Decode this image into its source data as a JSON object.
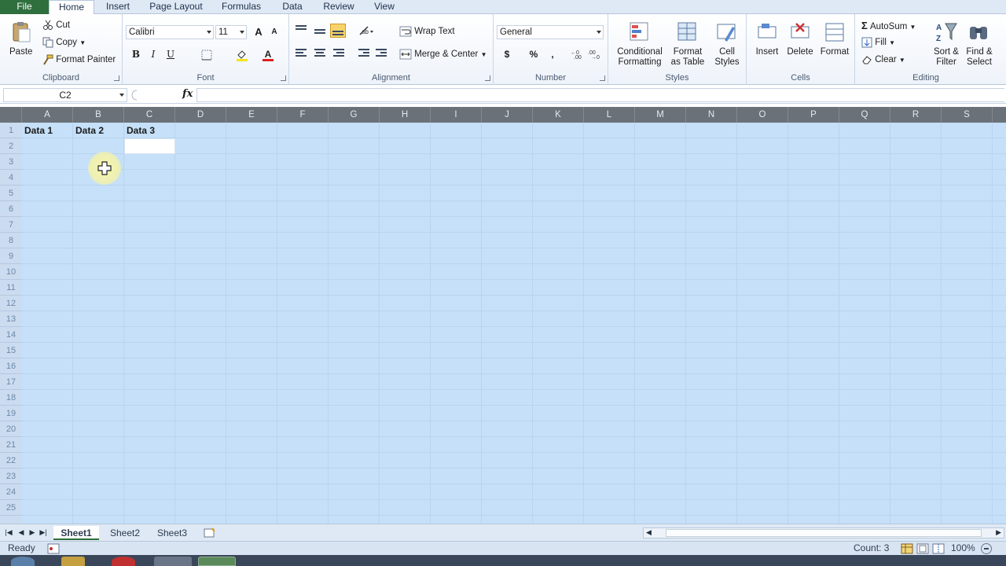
{
  "tabs": [
    "File",
    "Home",
    "Insert",
    "Page Layout",
    "Formulas",
    "Data",
    "Review",
    "View"
  ],
  "clipboard": {
    "paste": "Paste",
    "cut": "Cut",
    "copy": "Copy",
    "format_painter": "Format Painter",
    "label": "Clipboard"
  },
  "font": {
    "name": "Calibri",
    "size": "11",
    "bold": "B",
    "italic": "I",
    "underline": "U",
    "grow": "A",
    "shrink": "A",
    "color_letter": "A",
    "label": "Font",
    "fill_color": "#f5e31c",
    "text_color": "#e02020"
  },
  "alignment": {
    "wrap_text": "Wrap Text",
    "merge_center": "Merge & Center",
    "label": "Alignment"
  },
  "number": {
    "format": "General",
    "currency": "$",
    "percent": "%",
    "comma": ",",
    "label": "Number"
  },
  "styles": {
    "conditional": "Conditional",
    "conditional2": "Formatting",
    "format_table": "Format",
    "format_table2": "as Table",
    "cell_styles": "Cell",
    "cell_styles2": "Styles",
    "label": "Styles"
  },
  "cells": {
    "insert": "Insert",
    "delete": "Delete",
    "format": "Format",
    "label": "Cells"
  },
  "editing": {
    "autosum": "AutoSum",
    "fill": "Fill",
    "clear": "Clear",
    "sort": "Sort &",
    "sort2": "Filter",
    "find": "Find &",
    "find2": "Select",
    "label": "Editing",
    "sigma": "Σ"
  },
  "formula_bar": {
    "name_box": "C2",
    "fx": "fx",
    "formula": ""
  },
  "grid": {
    "columns": [
      "A",
      "B",
      "C",
      "D",
      "E",
      "F",
      "G",
      "H",
      "I",
      "J",
      "K",
      "L",
      "M",
      "N",
      "O",
      "P",
      "Q",
      "R",
      "S"
    ],
    "rows": [
      "1",
      "2",
      "3",
      "4",
      "5",
      "6",
      "7",
      "8",
      "9",
      "10",
      "11",
      "12",
      "13",
      "14",
      "15",
      "16",
      "17",
      "18",
      "19",
      "20",
      "21",
      "22",
      "23",
      "24",
      "25"
    ],
    "cells": {
      "A1": "Data 1",
      "B1": "Data 2",
      "C1": "Data 3"
    },
    "selection_color": "#c5e0f8"
  },
  "sheets": [
    "Sheet1",
    "Sheet2",
    "Sheet3"
  ],
  "status": {
    "ready": "Ready",
    "count": "Count: 3",
    "zoom": "100%"
  }
}
